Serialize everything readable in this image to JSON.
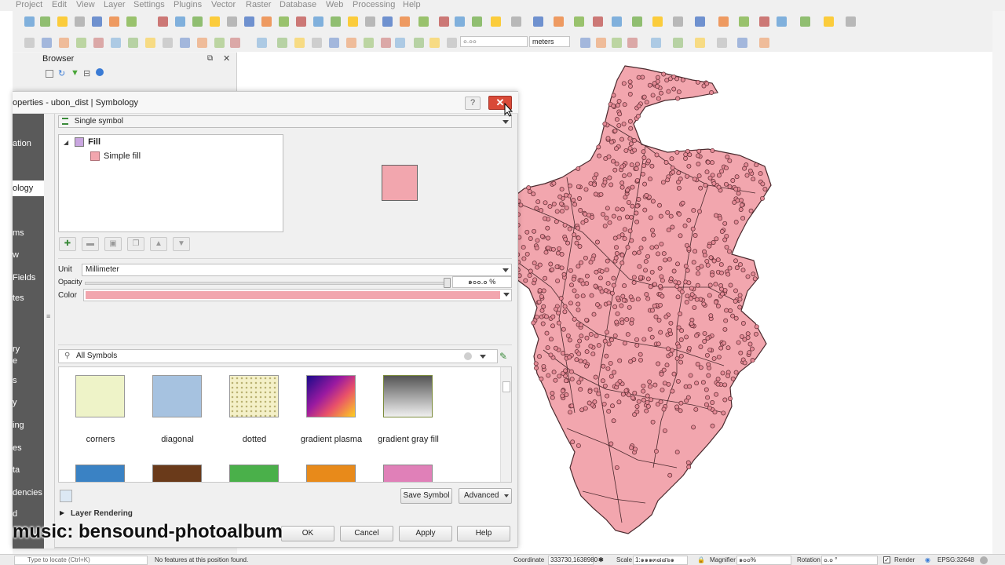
{
  "menu": [
    "Project",
    "Edit",
    "View",
    "Layer",
    "Settings",
    "Plugins",
    "Vector",
    "Raster",
    "Database",
    "Web",
    "Processing",
    "Help"
  ],
  "toolbar2": {
    "measure_value": "๐.๐๐",
    "units": "meters"
  },
  "browser": {
    "title": "Browser"
  },
  "dialog": {
    "title": "operties - ubon_dist | Symbology",
    "help": "?",
    "close": "✕",
    "sidebar_items": [
      "ation",
      "ology",
      "ms",
      "w",
      "Fields",
      "tes",
      "ry",
      "e",
      "s",
      "y",
      "ing",
      "es",
      "ta",
      "dencies",
      "d"
    ],
    "renderer": "Single symbol",
    "tree": {
      "fill": "Fill",
      "simple_fill": "Simple fill"
    },
    "unit_label": "Unit",
    "unit_value": "Millimeter",
    "opacity_label": "Opacity",
    "opacity_value": "๑๐๐.๐ %",
    "color_label": "Color",
    "search_value": "All Symbols",
    "symbols": [
      {
        "name": "corners"
      },
      {
        "name": "diagonal"
      },
      {
        "name": "dotted"
      },
      {
        "name": "gradient  plasma"
      },
      {
        "name": "gradient  gray fill"
      }
    ],
    "save_symbol": "Save Symbol",
    "advanced": "Advanced",
    "layer_rendering": "Layer Rendering",
    "ok": "OK",
    "cancel": "Cancel",
    "apply": "Apply",
    "help_btn": "Help"
  },
  "caption": "music: bensound-photoalbum",
  "status": {
    "locate_placeholder": "Type to locate (Ctrl+K)",
    "message": "No features at this position found.",
    "coordinate_label": "Coordinate",
    "coordinate_value": "333730,1638980",
    "scale_label": "Scale",
    "scale_value": "1:๑๑๑๓๘๘๖๑",
    "magnifier_label": "Magnifier",
    "magnifier_value": "๑๐๐%",
    "rotation_label": "Rotation",
    "rotation_value": "๐.๐ °",
    "render_label": "Render",
    "crs": "EPSG:32648"
  },
  "colors": {
    "fill": "#f2a6ae",
    "outline": "#4a2a2e",
    "close": "#d94a38",
    "sidebar": "#5a5a5a"
  }
}
